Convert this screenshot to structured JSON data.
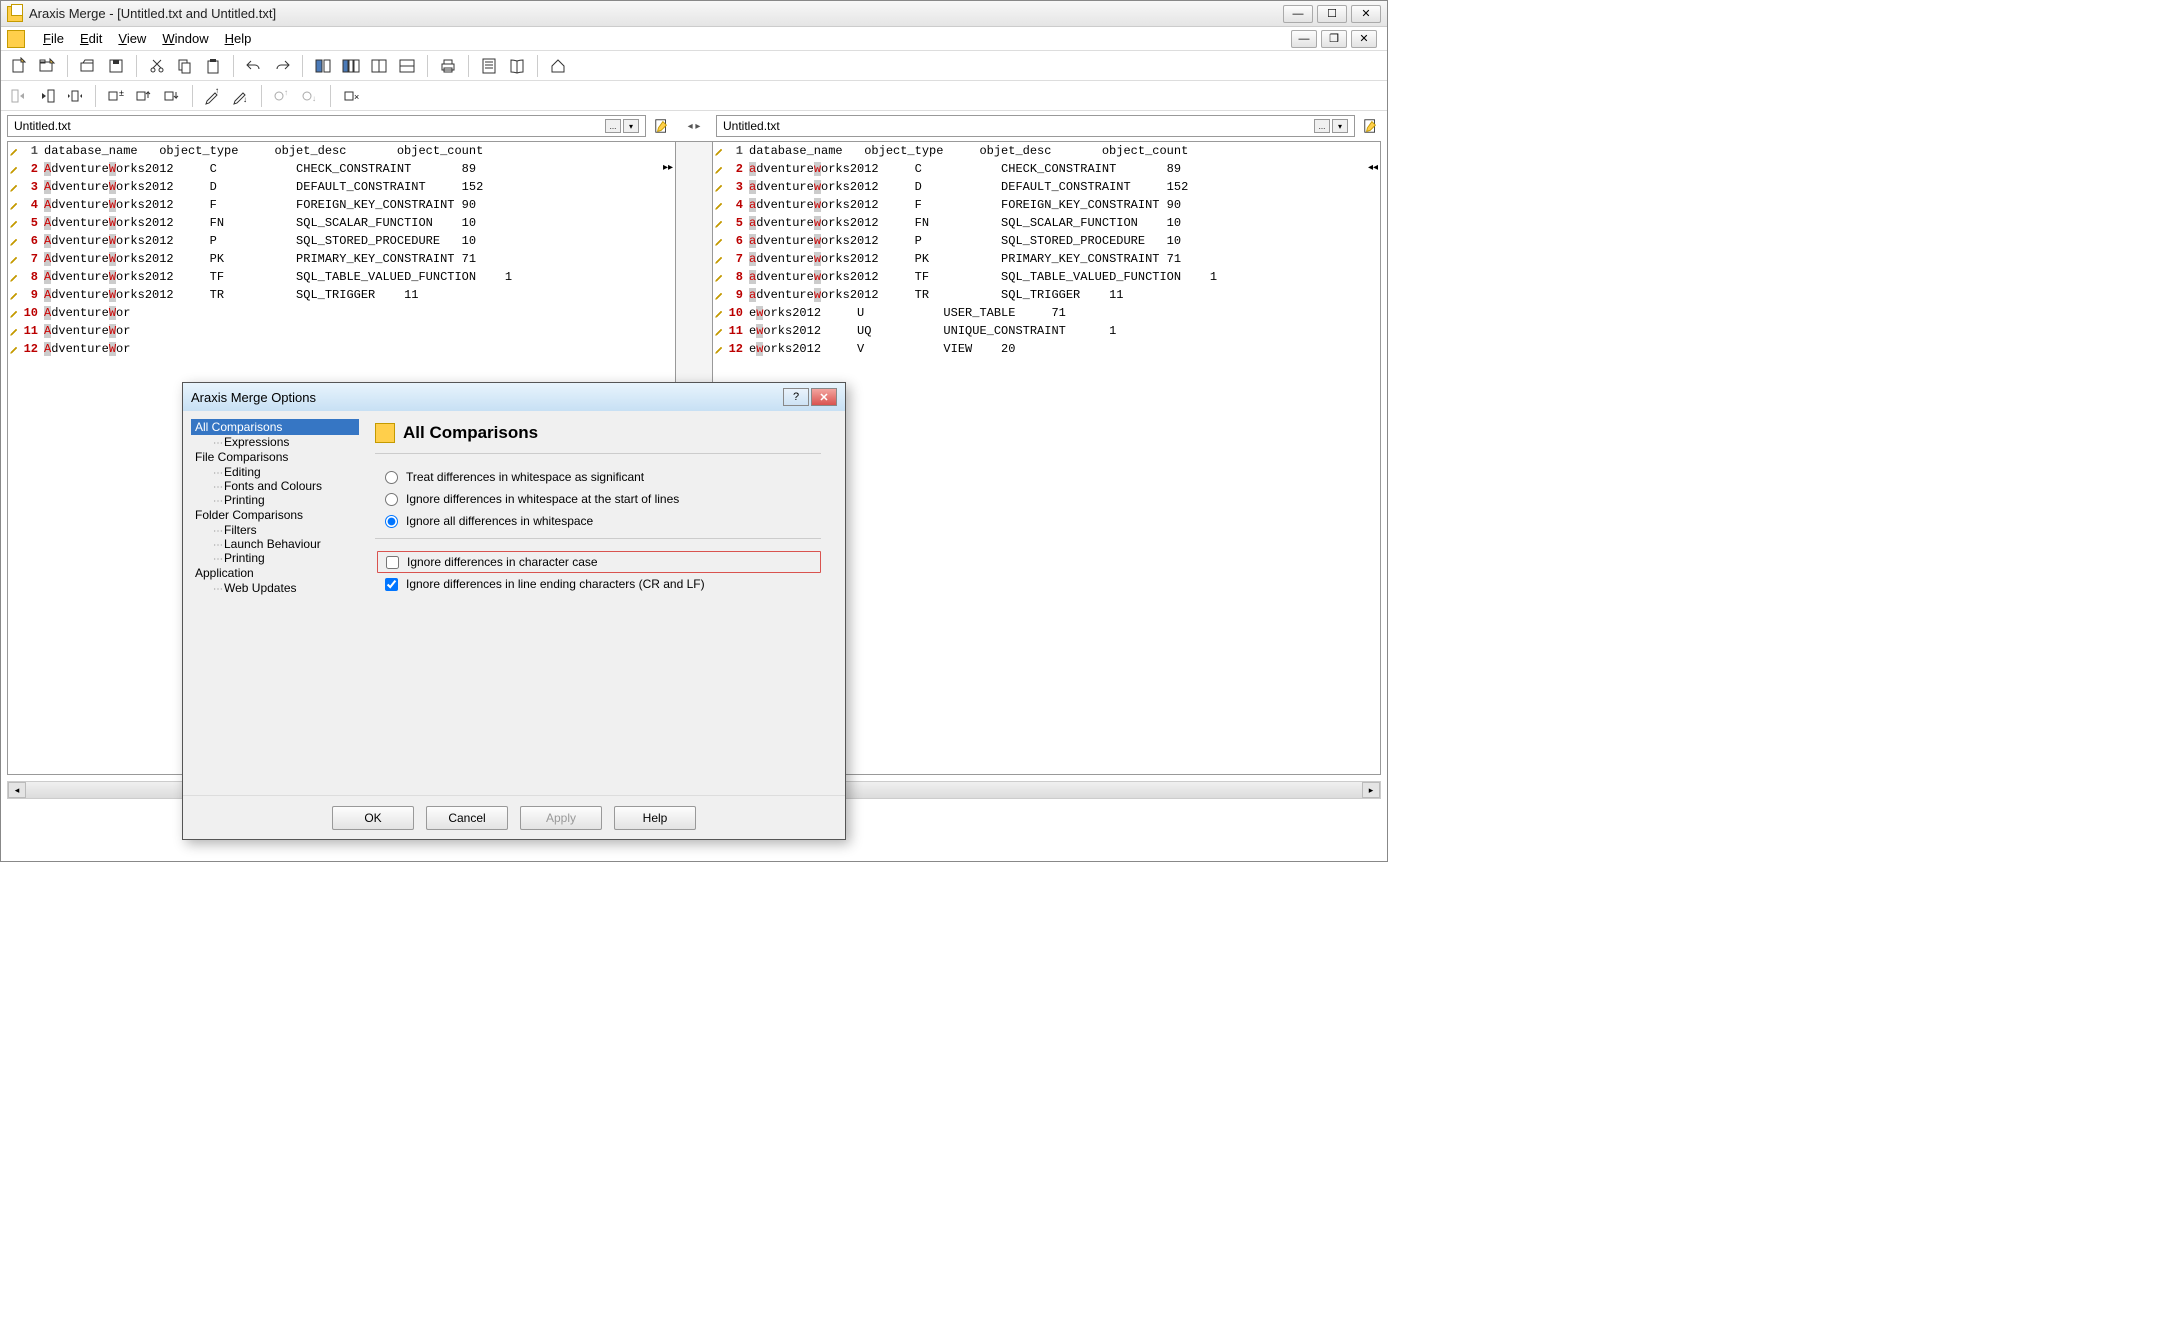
{
  "window": {
    "title": "Araxis Merge - [Untitled.txt and Untitled.txt]"
  },
  "menu": {
    "items": [
      "File",
      "Edit",
      "View",
      "Window",
      "Help"
    ]
  },
  "files": {
    "left": "Untitled.txt",
    "right": "Untitled.txt"
  },
  "columns_header": "1   database_name   object_type     objet_desc       object_count",
  "left_rows": [
    {
      "n": "1",
      "diff": false,
      "a": "",
      "w": "",
      "rest": "database_name   object_type     objet_desc       object_count"
    },
    {
      "n": "2",
      "diff": true,
      "a": "A",
      "w": "W",
      "rest": "dventure",
      "tail": "orks2012     C           CHECK_CONSTRAINT       89"
    },
    {
      "n": "3",
      "diff": true,
      "a": "A",
      "w": "W",
      "rest": "dventure",
      "tail": "orks2012     D           DEFAULT_CONSTRAINT     152"
    },
    {
      "n": "4",
      "diff": true,
      "a": "A",
      "w": "W",
      "rest": "dventure",
      "tail": "orks2012     F           FOREIGN_KEY_CONSTRAINT 90"
    },
    {
      "n": "5",
      "diff": true,
      "a": "A",
      "w": "W",
      "rest": "dventure",
      "tail": "orks2012     FN          SQL_SCALAR_FUNCTION    10"
    },
    {
      "n": "6",
      "diff": true,
      "a": "A",
      "w": "W",
      "rest": "dventure",
      "tail": "orks2012     P           SQL_STORED_PROCEDURE   10"
    },
    {
      "n": "7",
      "diff": true,
      "a": "A",
      "w": "W",
      "rest": "dventure",
      "tail": "orks2012     PK          PRIMARY_KEY_CONSTRAINT 71"
    },
    {
      "n": "8",
      "diff": true,
      "a": "A",
      "w": "W",
      "rest": "dventure",
      "tail": "orks2012     TF          SQL_TABLE_VALUED_FUNCTION    1"
    },
    {
      "n": "9",
      "diff": true,
      "a": "A",
      "w": "W",
      "rest": "dventure",
      "tail": "orks2012     TR          SQL_TRIGGER    11"
    },
    {
      "n": "10",
      "diff": true,
      "a": "A",
      "w": "W",
      "rest": "dventure",
      "tail": "or"
    },
    {
      "n": "11",
      "diff": true,
      "a": "A",
      "w": "W",
      "rest": "dventure",
      "tail": "or"
    },
    {
      "n": "12",
      "diff": true,
      "a": "A",
      "w": "W",
      "rest": "dventure",
      "tail": "or"
    }
  ],
  "right_rows": [
    {
      "n": "1",
      "diff": false,
      "a": "",
      "w": "",
      "rest": "database_name   object_type     objet_desc       object_count"
    },
    {
      "n": "2",
      "diff": true,
      "a": "a",
      "w": "w",
      "rest": "dventure",
      "tail": "orks2012     C           CHECK_CONSTRAINT       89"
    },
    {
      "n": "3",
      "diff": true,
      "a": "a",
      "w": "w",
      "rest": "dventure",
      "tail": "orks2012     D           DEFAULT_CONSTRAINT     152"
    },
    {
      "n": "4",
      "diff": true,
      "a": "a",
      "w": "w",
      "rest": "dventure",
      "tail": "orks2012     F           FOREIGN_KEY_CONSTRAINT 90"
    },
    {
      "n": "5",
      "diff": true,
      "a": "a",
      "w": "w",
      "rest": "dventure",
      "tail": "orks2012     FN          SQL_SCALAR_FUNCTION    10"
    },
    {
      "n": "6",
      "diff": true,
      "a": "a",
      "w": "w",
      "rest": "dventure",
      "tail": "orks2012     P           SQL_STORED_PROCEDURE   10"
    },
    {
      "n": "7",
      "diff": true,
      "a": "a",
      "w": "w",
      "rest": "dventure",
      "tail": "orks2012     PK          PRIMARY_KEY_CONSTRAINT 71"
    },
    {
      "n": "8",
      "diff": true,
      "a": "a",
      "w": "w",
      "rest": "dventure",
      "tail": "orks2012     TF          SQL_TABLE_VALUED_FUNCTION    1"
    },
    {
      "n": "9",
      "diff": true,
      "a": "a",
      "w": "w",
      "rest": "dventure",
      "tail": "orks2012     TR          SQL_TRIGGER    11"
    },
    {
      "n": "10",
      "diff": true,
      "a": "",
      "w": "w",
      "rest": "e",
      "tail": "orks2012     U           USER_TABLE     71"
    },
    {
      "n": "11",
      "diff": true,
      "a": "",
      "w": "w",
      "rest": "e",
      "tail": "orks2012     UQ          UNIQUE_CONSTRAINT      1"
    },
    {
      "n": "12",
      "diff": true,
      "a": "",
      "w": "w",
      "rest": "e",
      "tail": "orks2012     V           VIEW    20"
    }
  ],
  "dialog": {
    "title": "Araxis Merge Options",
    "heading": "All Comparisons",
    "tree": {
      "all_comparisons": "All Comparisons",
      "expressions": "Expressions",
      "file_comparisons": "File Comparisons",
      "editing": "Editing",
      "fonts_colours": "Fonts and Colours",
      "printing": "Printing",
      "folder_comparisons": "Folder Comparisons",
      "filters": "Filters",
      "launch_behaviour": "Launch Behaviour",
      "printing2": "Printing",
      "application": "Application",
      "web_updates": "Web Updates"
    },
    "radios": {
      "r1": "Treat differences in whitespace as significant",
      "r2": "Ignore differences in whitespace at the start of lines",
      "r3": "Ignore all differences in whitespace"
    },
    "checks": {
      "c1": "Ignore differences in character case",
      "c2": "Ignore differences in line ending characters (CR and LF)"
    },
    "buttons": {
      "ok": "OK",
      "cancel": "Cancel",
      "apply": "Apply",
      "help": "Help"
    }
  }
}
